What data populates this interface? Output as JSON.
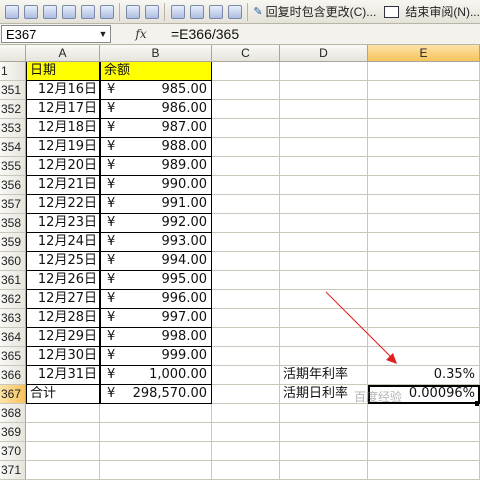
{
  "toolbar": {
    "reply_label": "回复时包含更改(C)...",
    "end_review_label": "结束审阅(N)..."
  },
  "formula_bar": {
    "name_box": "E367",
    "fx_label": "fx",
    "formula": "=E366/365"
  },
  "columns": [
    "A",
    "B",
    "C",
    "D",
    "E"
  ],
  "header_row": {
    "row": "1",
    "a": "日期",
    "b": "余额"
  },
  "rows": [
    {
      "row": "351",
      "date": "12月16日",
      "yen": "¥",
      "amount": "985.00"
    },
    {
      "row": "352",
      "date": "12月17日",
      "yen": "¥",
      "amount": "986.00"
    },
    {
      "row": "353",
      "date": "12月18日",
      "yen": "¥",
      "amount": "987.00"
    },
    {
      "row": "354",
      "date": "12月19日",
      "yen": "¥",
      "amount": "988.00"
    },
    {
      "row": "355",
      "date": "12月20日",
      "yen": "¥",
      "amount": "989.00"
    },
    {
      "row": "356",
      "date": "12月21日",
      "yen": "¥",
      "amount": "990.00"
    },
    {
      "row": "357",
      "date": "12月22日",
      "yen": "¥",
      "amount": "991.00"
    },
    {
      "row": "358",
      "date": "12月23日",
      "yen": "¥",
      "amount": "992.00"
    },
    {
      "row": "359",
      "date": "12月24日",
      "yen": "¥",
      "amount": "993.00"
    },
    {
      "row": "360",
      "date": "12月25日",
      "yen": "¥",
      "amount": "994.00"
    },
    {
      "row": "361",
      "date": "12月26日",
      "yen": "¥",
      "amount": "995.00"
    },
    {
      "row": "362",
      "date": "12月27日",
      "yen": "¥",
      "amount": "996.00"
    },
    {
      "row": "363",
      "date": "12月28日",
      "yen": "¥",
      "amount": "997.00"
    },
    {
      "row": "364",
      "date": "12月29日",
      "yen": "¥",
      "amount": "998.00"
    },
    {
      "row": "365",
      "date": "12月30日",
      "yen": "¥",
      "amount": "999.00"
    },
    {
      "row": "366",
      "date": "12月31日",
      "yen": "¥",
      "amount": "1,000.00",
      "d": "活期年利率",
      "e": "0.35%"
    }
  ],
  "total_row": {
    "row": "367",
    "a": "合计",
    "yen": "¥",
    "amount": "298,570.00",
    "d": "活期日利率",
    "e": "0.00096%"
  },
  "empty_rows": [
    "369",
    "370",
    "371"
  ],
  "row_368": "368",
  "watermark": "百度经验",
  "colors": {
    "header_fill": "#ffff00",
    "arrow": "#e02020",
    "selected_header": "#f6c35e"
  }
}
